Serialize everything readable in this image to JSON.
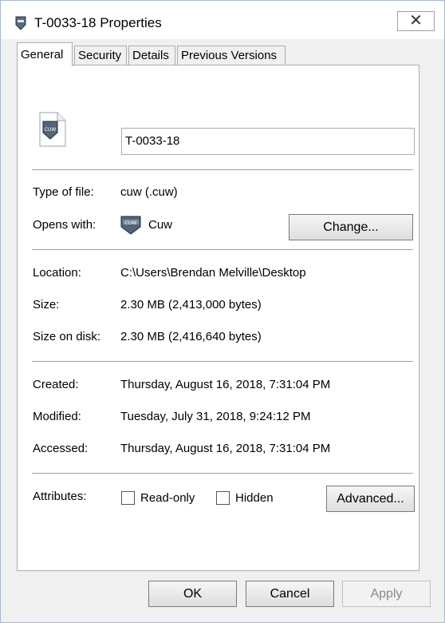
{
  "window": {
    "title": "T-0033-18 Properties",
    "close_label": "✕"
  },
  "tabs": [
    {
      "label": "General",
      "active": true
    },
    {
      "label": "Security",
      "active": false
    },
    {
      "label": "Details",
      "active": false
    },
    {
      "label": "Previous Versions",
      "active": false
    }
  ],
  "general": {
    "file_icon_text": "CUW",
    "file_name": "T-0033-18",
    "type_label": "Type of file:",
    "type_value": "cuw (.cuw)",
    "opens_label": "Opens with:",
    "opens_app_icon_text": "CUW",
    "opens_value": "Cuw",
    "change_button": "Change...",
    "location_label": "Location:",
    "location_value": "C:\\Users\\Brendan Melville\\Desktop",
    "size_label": "Size:",
    "size_value": "2.30 MB (2,413,000 bytes)",
    "size_disk_label": "Size on disk:",
    "size_disk_value": "2.30 MB (2,416,640 bytes)",
    "created_label": "Created:",
    "created_value": "Thursday, August 16, 2018, 7:31:04 PM",
    "modified_label": "Modified:",
    "modified_value": "Tuesday, July 31, 2018, 9:24:12 PM",
    "accessed_label": "Accessed:",
    "accessed_value": "Thursday, August 16, 2018, 7:31:04 PM",
    "attributes_label": "Attributes:",
    "readonly_label": "Read-only",
    "readonly_checked": false,
    "hidden_label": "Hidden",
    "hidden_checked": false,
    "advanced_button": "Advanced..."
  },
  "footer": {
    "ok_label": "OK",
    "cancel_label": "Cancel",
    "apply_label": "Apply"
  }
}
